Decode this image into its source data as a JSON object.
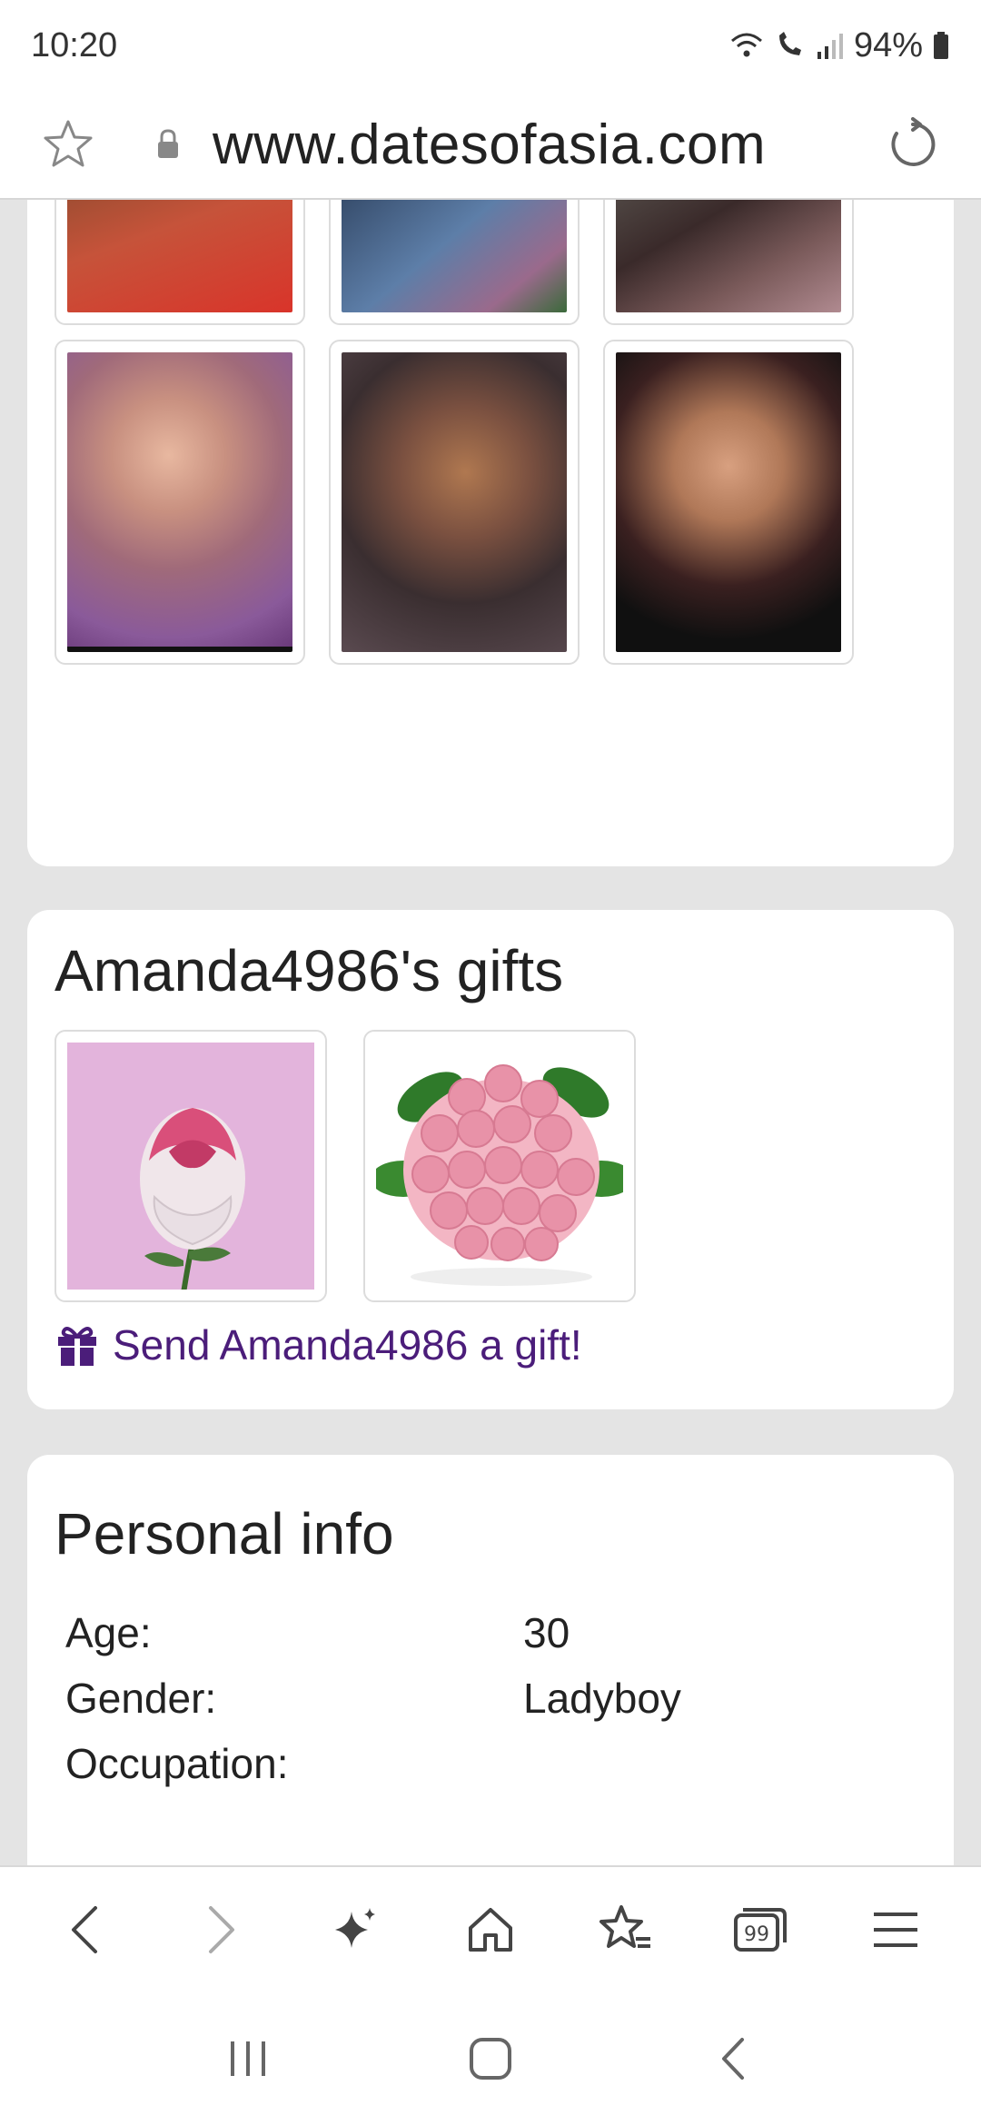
{
  "status_bar": {
    "time": "10:20",
    "battery": "94%",
    "icons": [
      "wifi-icon",
      "wifi-call-icon",
      "signal-icon",
      "battery-icon"
    ]
  },
  "url_bar": {
    "url": "www.datesofasia.com",
    "icons": [
      "star-icon",
      "lock-icon",
      "reload-icon"
    ]
  },
  "photos": {
    "count": 6
  },
  "gifts": {
    "title": "Amanda4986's gifts",
    "send_label": "Send Amanda4986 a gift!",
    "items": [
      "rose-gift",
      "rose-bouquet-gift"
    ]
  },
  "personal_info": {
    "title": "Personal info",
    "rows": [
      {
        "label": "Age:",
        "value": "30"
      },
      {
        "label": "Gender:",
        "value": "Ladyboy"
      },
      {
        "label": "Occupation:",
        "value": ""
      }
    ]
  },
  "browser_nav": {
    "icons": [
      "back-icon",
      "forward-icon",
      "sparkle-icon",
      "home-icon",
      "bookmarks-icon",
      "tabs-icon",
      "menu-icon"
    ],
    "tabs_count": "99"
  },
  "system_nav": {
    "icons": [
      "recents-icon",
      "home-circle-icon",
      "system-back-icon"
    ]
  },
  "colors": {
    "link": "#4b1d7a",
    "page_bg": "#e4e4e4",
    "card_bg": "#ffffff"
  }
}
